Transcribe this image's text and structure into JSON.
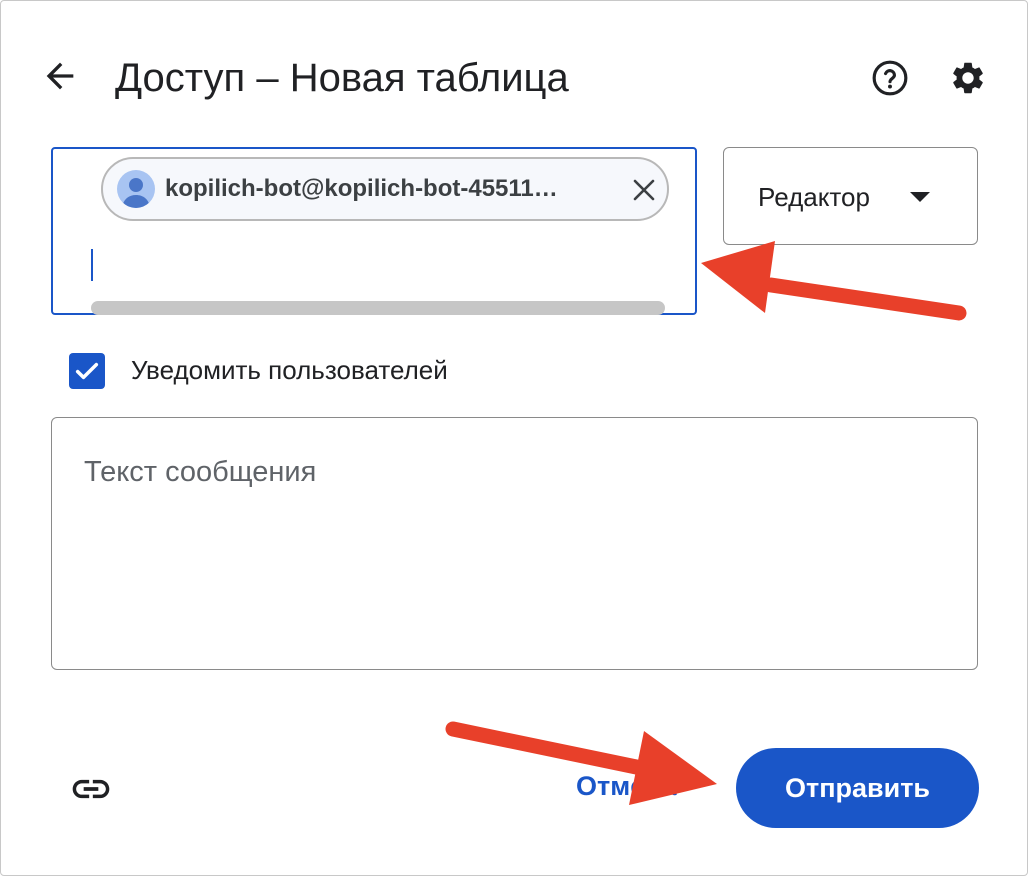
{
  "dialog": {
    "title": "Доступ – Новая таблица"
  },
  "recipients": {
    "chips": [
      {
        "email": "kopilich-bot@kopilich-bot-45511…"
      }
    ]
  },
  "role_select": {
    "selected": "Редактор"
  },
  "notify": {
    "label": "Уведомить пользователей",
    "checked": true
  },
  "message": {
    "placeholder": "Текст сообщения"
  },
  "actions": {
    "cancel_label": "Отмена",
    "send_label": "Отправить"
  },
  "icons": {
    "back": "arrow-back-icon",
    "help": "help-circle-icon",
    "settings": "gear-icon",
    "avatar": "person-avatar-icon",
    "remove": "close-icon",
    "dropdown": "triangle-down-icon",
    "checkmark": "checkmark-icon",
    "link": "link-icon"
  },
  "colors": {
    "accent": "#1a56c8",
    "annotation_arrow": "#e8402a",
    "text": "#202124"
  }
}
